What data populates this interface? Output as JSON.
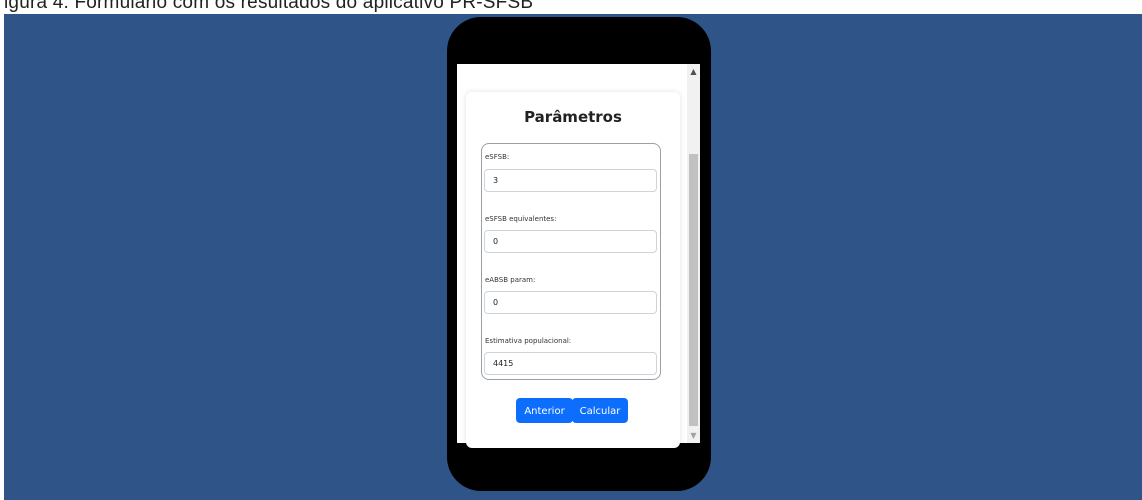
{
  "caption_fragment": "igura 4. Formulário com os resultados do aplicativo PR-SFSB",
  "form": {
    "title": "Parâmetros",
    "fields": [
      {
        "label": "eSFSB:",
        "value": "3"
      },
      {
        "label": "eSFSB equivalentes:",
        "value": "0"
      },
      {
        "label": "eABSB param:",
        "value": "0"
      },
      {
        "label": "Estimativa populacional:",
        "value": "4415"
      }
    ],
    "buttons": {
      "previous": "Anterior",
      "calculate": "Calcular"
    }
  },
  "scrollbar": {
    "up_arrow": "▲",
    "down_arrow": "▼"
  },
  "colors": {
    "background": "#2f5488",
    "primary_button": "#0d6efd",
    "phone": "#000000"
  }
}
